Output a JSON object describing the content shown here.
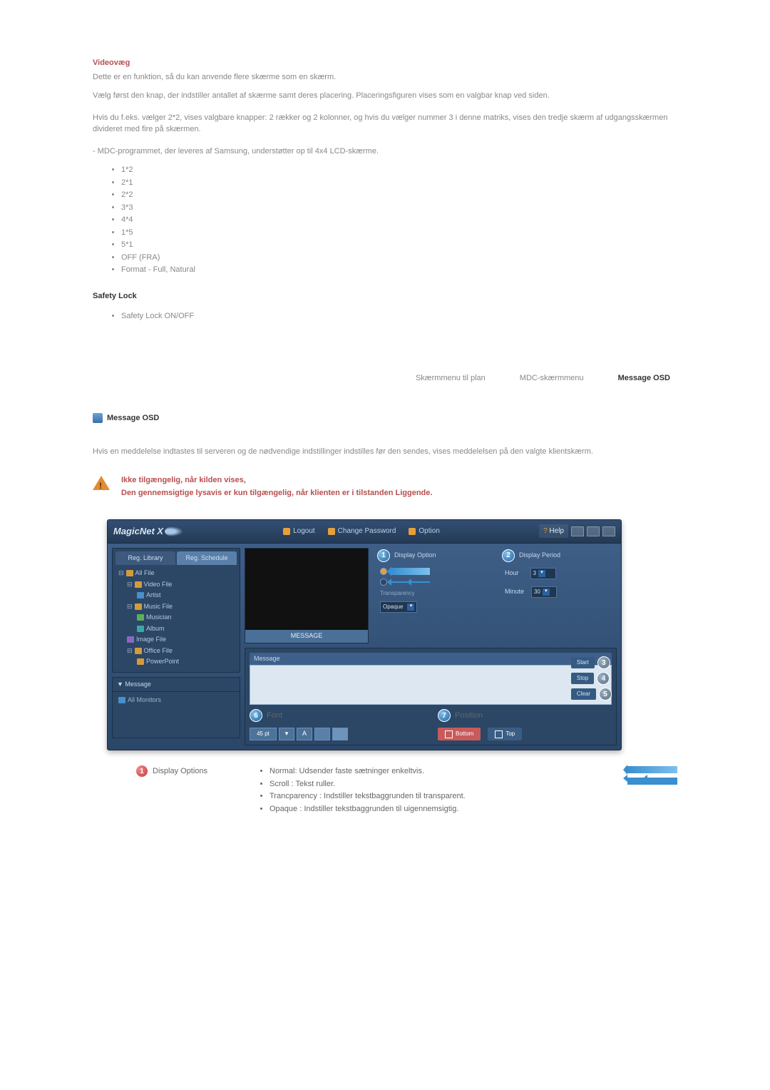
{
  "sections": {
    "videowall": {
      "title": "Videovæg",
      "p1": "Dette er en funktion, så du kan anvende flere skærme som en skærm.",
      "p2": "Vælg først den knap, der indstiller antallet af skærme samt deres placering. Placeringsfiguren vises som en valgbar knap ved siden.",
      "p3": "Hvis du f.eks. vælger 2*2, vises valgbare knapper: 2 rækker og 2 kolonner, og hvis du vælger nummer 3 i denne matriks, vises den tredje skærm af udgangsskærmen divideret med fire på skærmen.",
      "p4": "- MDC-programmet, der leveres af Samsung, understøtter op til 4x4 LCD-skærme.",
      "options": [
        "1*2",
        "2*1",
        "2*2",
        "3*3",
        "4*4",
        "1*5",
        "5*1",
        "OFF (FRA)",
        "Format - Full, Natural"
      ]
    },
    "safety_lock": {
      "title": "Safety Lock",
      "item": "Safety Lock ON/OFF"
    },
    "nav": {
      "item1": "Skærmmenu til plan",
      "item2": "MDC-skærmmenu",
      "item3": "Message OSD"
    },
    "message_osd": {
      "label": "Message OSD",
      "intro": "Hvis en meddelelse indtastes til serveren og de nødvendige indstillinger indstilles før den sendes, vises meddelelsen på den valgte klientskærm.",
      "warning_l1": "Ikke tilgængelig, når kilden vises,",
      "warning_l2": "Den gennemsigtige lysavis er kun tilgængelig, når klienten er i tilstanden Liggende."
    },
    "app": {
      "logo": "MagicNet X",
      "header": {
        "logout": "Logout",
        "change_password": "Change Password",
        "option": "Option",
        "help": "Help"
      },
      "tabs": {
        "reg_library": "Reg. Library",
        "reg_schedule": "Reg. Schedule"
      },
      "tree": {
        "all_file": "All File",
        "video_file": "Video File",
        "artist": "Artist",
        "music_file": "Music File",
        "musician": "Musician",
        "album": "Album",
        "image_file": "Image File",
        "office_file": "Office File",
        "powerpoint": "PowerPoint"
      },
      "message_panel": {
        "header": "▼   Message",
        "item": "All Monitors"
      },
      "preview_label": "MESSAGE",
      "display_option": {
        "title": "Display Option",
        "transparency": "Transparency",
        "opaque": "Opaque"
      },
      "display_period": {
        "title": "Display Period",
        "hour": "Hour",
        "hour_val": "3",
        "minute": "Minute",
        "minute_val": "30"
      },
      "buttons": {
        "start": "Start",
        "stop": "Stop",
        "clear": "Clear"
      },
      "lower": {
        "message": "Message",
        "font": "Font",
        "font_size": "45 pt",
        "a": "A",
        "position": "Position",
        "bottom": "Bottom",
        "top": "Top"
      },
      "numbers": {
        "n1": "1",
        "n2": "2",
        "n3": "3",
        "n4": "4",
        "n5": "5",
        "n6": "6",
        "n7": "7"
      }
    },
    "legend": {
      "title": "Display Options",
      "items": [
        "Normal: Udsender faste sætninger enkeltvis.",
        "Scroll : Tekst ruller.",
        "Trancparency : Indstiller tekstbaggrunden til transparent.",
        "Opaque : Indstiller tekstbaggrunden til uigennemsigtig."
      ]
    }
  }
}
